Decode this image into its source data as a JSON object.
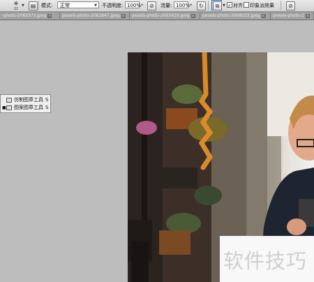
{
  "options_bar": {
    "tool_icon": "clone-stamp-icon",
    "brush_size": "21",
    "mode_label": "模式:",
    "mode_value": "正常",
    "opacity_label": "不透明度:",
    "opacity_value": "100%",
    "flow_label": "流量:",
    "flow_value": "100%",
    "aligned_label": "对齐",
    "aligned_checked": true,
    "sample_pattern_label": "印象派效果",
    "sample_pattern_checked": false
  },
  "tabs": [
    {
      "label": "-photo-2062373.jpeg"
    },
    {
      "label": "pexels-photo-2062847.jpeg"
    },
    {
      "label": "pexels-photo-2065429.jpeg"
    },
    {
      "label": "pexels-photo-2068033.jpeg"
    },
    {
      "label": "pexels-photo-2"
    }
  ],
  "tool_flyout": {
    "items": [
      {
        "label": "仿制图章工具",
        "shortcut": "S",
        "selected": false
      },
      {
        "label": "图案图章工具",
        "shortcut": "S",
        "selected": true
      }
    ]
  },
  "watermark": {
    "text": "软件技巧"
  },
  "colors": {
    "accent": "#3b6fb6",
    "workspace": "#bdbdbd"
  }
}
